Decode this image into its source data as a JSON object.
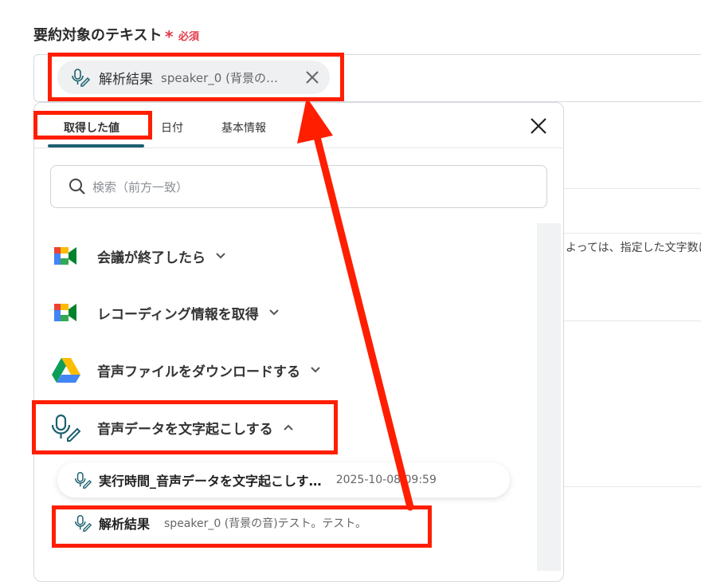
{
  "field": {
    "label": "要約対象のテキスト",
    "required_mark": "*",
    "required_text": "必須"
  },
  "selected_chip": {
    "title": "解析結果",
    "value": "speaker_0 (背景の…",
    "icon": "mic-pen-icon"
  },
  "background": {
    "text": "よっては、指定した文字数に"
  },
  "panel": {
    "tabs": [
      {
        "label": "取得した値",
        "active": true
      },
      {
        "label": "日付"
      },
      {
        "label": "基本情報"
      }
    ],
    "search_placeholder": "検索（前方一致）",
    "groups": [
      {
        "label": "会議が終了したら",
        "icon": "google-meet-icon",
        "expanded": false
      },
      {
        "label": "レコーディング情報を取得",
        "icon": "google-meet-icon",
        "expanded": false
      },
      {
        "label": "音声ファイルをダウンロードする",
        "icon": "google-drive-icon",
        "expanded": false
      },
      {
        "label": "音声データを文字起こしする",
        "icon": "mic-pen-icon",
        "expanded": true
      }
    ],
    "items": [
      {
        "title": "実行時間_音声データを文字起こしす…",
        "value": "2025-10-08 09:59"
      },
      {
        "title": "解析結果",
        "value": "speaker_0 (背景の音)テスト。テスト。"
      }
    ]
  },
  "colors": {
    "accent": "#1d6170",
    "highlight": "#ff1e00",
    "required": "#e23b4b"
  }
}
